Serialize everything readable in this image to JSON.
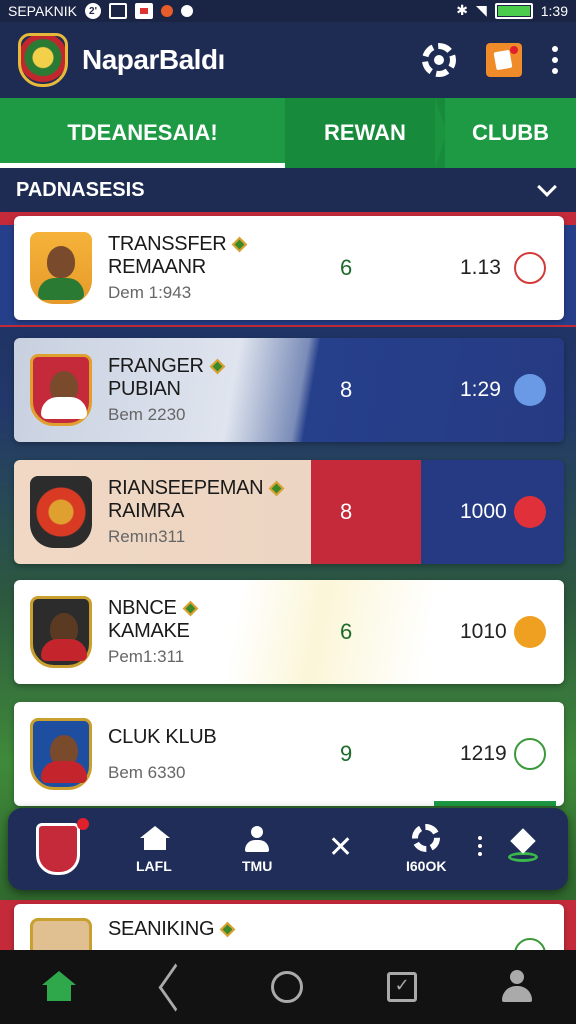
{
  "status_bar": {
    "carrier": "SEPAKNIK",
    "notification_count": "2'",
    "time": "1:39"
  },
  "app_bar": {
    "title": "NaparBaldı"
  },
  "tabs": [
    {
      "label": "TDEANESAIA!",
      "active": true
    },
    {
      "label": "REWAN",
      "active": false
    },
    {
      "label": "CLUBB",
      "active": false
    }
  ],
  "section": {
    "title": "PADNASESIS"
  },
  "players": [
    {
      "name1": "TRANSSFER",
      "name2": "REMAANR",
      "sub": "Dem 1:943",
      "score": "6",
      "value": "1.13",
      "action_icon": "ball-icon",
      "accent": "#d33a3a",
      "jersey": "#c4242c",
      "bg": "#f5b33a"
    },
    {
      "name1": "FRANGER",
      "name2": "PUBIAN",
      "sub": "Bem 2230",
      "score": "8",
      "value": "1:29",
      "action_icon": "send-icon",
      "accent": "#5a8ee0",
      "jersey": "#c4242c",
      "bg": "#c42a3a"
    },
    {
      "name1": "RIANSEEPEMAN",
      "name2": "RAIMRA",
      "sub": "Remın311",
      "score": "8",
      "value": "1000",
      "action_icon": "plane-icon",
      "accent": "#e0303a",
      "jersey": "#d93a24",
      "bg": "#e0a030"
    },
    {
      "name1": "NBNCE",
      "name2": "KAMAKE",
      "sub": "Pem1:311",
      "score": "6",
      "value": "1010",
      "action_icon": "hand-icon",
      "accent": "#f0a020",
      "jersey": "#c4242c",
      "bg": "#2c2c2c"
    },
    {
      "name1": "CLUK KLUB",
      "name2": "",
      "sub": "Bem 6330",
      "score": "9",
      "value": "1219",
      "action_icon": "whistle-icon",
      "accent": "#3a9a3a",
      "jersey": "#d33a3a",
      "bg": "#1e4ea0"
    },
    {
      "name1": "SEANIKING",
      "name2": "",
      "sub": "",
      "score": "",
      "value": "",
      "action_icon": "whistle-icon",
      "accent": "#3a9a3a",
      "jersey": "#c4242c",
      "bg": "#e0c090"
    }
  ],
  "float_bar": {
    "items": [
      {
        "label": "LAFL",
        "icon": "home-icon"
      },
      {
        "label": "TMU",
        "icon": "player-icon"
      },
      {
        "label": "",
        "icon": "close-icon"
      },
      {
        "label": "I60OK",
        "icon": "gear-icon"
      }
    ]
  },
  "colors": {
    "brand_navy": "#1e2b52",
    "brand_green": "#1e9a44",
    "brand_red": "#c42a3a"
  }
}
